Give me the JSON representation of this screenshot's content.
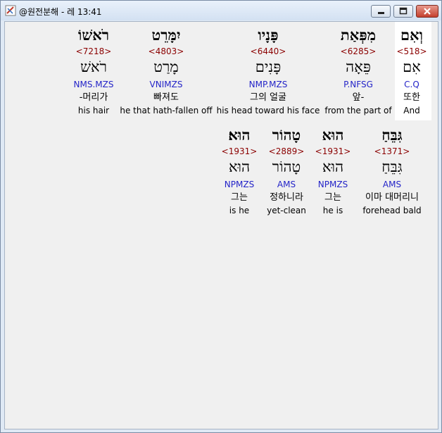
{
  "window": {
    "title": "@원전분해 - 레 13:41"
  },
  "rows": [
    {
      "words": [
        {
          "hebrew": "וְאִם",
          "strong": "<518>",
          "lemma": "אִם",
          "parse": "C.Q",
          "korean": "또한",
          "english": "And",
          "highlight": true
        },
        {
          "hebrew": "מִפְּאַת",
          "strong": "<6285>",
          "lemma": "פֵּאָה",
          "parse": "P.NFSG",
          "korean": "앞-",
          "english": "from the part of"
        },
        {
          "hebrew": "פָּנָיו",
          "strong": "<6440>",
          "lemma": "פָּנִים",
          "parse": "NMP.MZS",
          "korean": "그의 얼굴",
          "english": "his head toward his face"
        },
        {
          "hebrew": "יִמָּרֵט",
          "strong": "<4803>",
          "lemma": "מָרַט",
          "parse": "VNIMZS",
          "korean": "빠져도",
          "english": "he that hath-fallen off"
        },
        {
          "hebrew": "רֹאשׁוֹ",
          "strong": "<7218>",
          "lemma": "רֹאשׁ",
          "parse": "NMS.MZS",
          "korean": "-머리가",
          "english": "his hair"
        }
      ]
    },
    {
      "words": [
        {
          "hebrew": "גִּבֵּחַ",
          "strong": "<1371>",
          "lemma": "גִּבֵּחַ",
          "parse": "AMS",
          "korean": "이마 대머리니",
          "english": "forehead bald"
        },
        {
          "hebrew": "הוּא",
          "strong": "<1931>",
          "lemma": "הוּא",
          "parse": "NPMZS",
          "korean": "그는",
          "english": "he is"
        },
        {
          "hebrew": "טָהוֹר",
          "strong": "<2889>",
          "lemma": "טָהוֹר",
          "parse": "AMS",
          "korean": "정하니라",
          "english": "yet-clean"
        },
        {
          "hebrew": "הוּא׃",
          "strong": "<1931>",
          "lemma": "הוּא",
          "parse": "NPMZS",
          "korean": "그는",
          "english": "is he"
        }
      ]
    }
  ]
}
